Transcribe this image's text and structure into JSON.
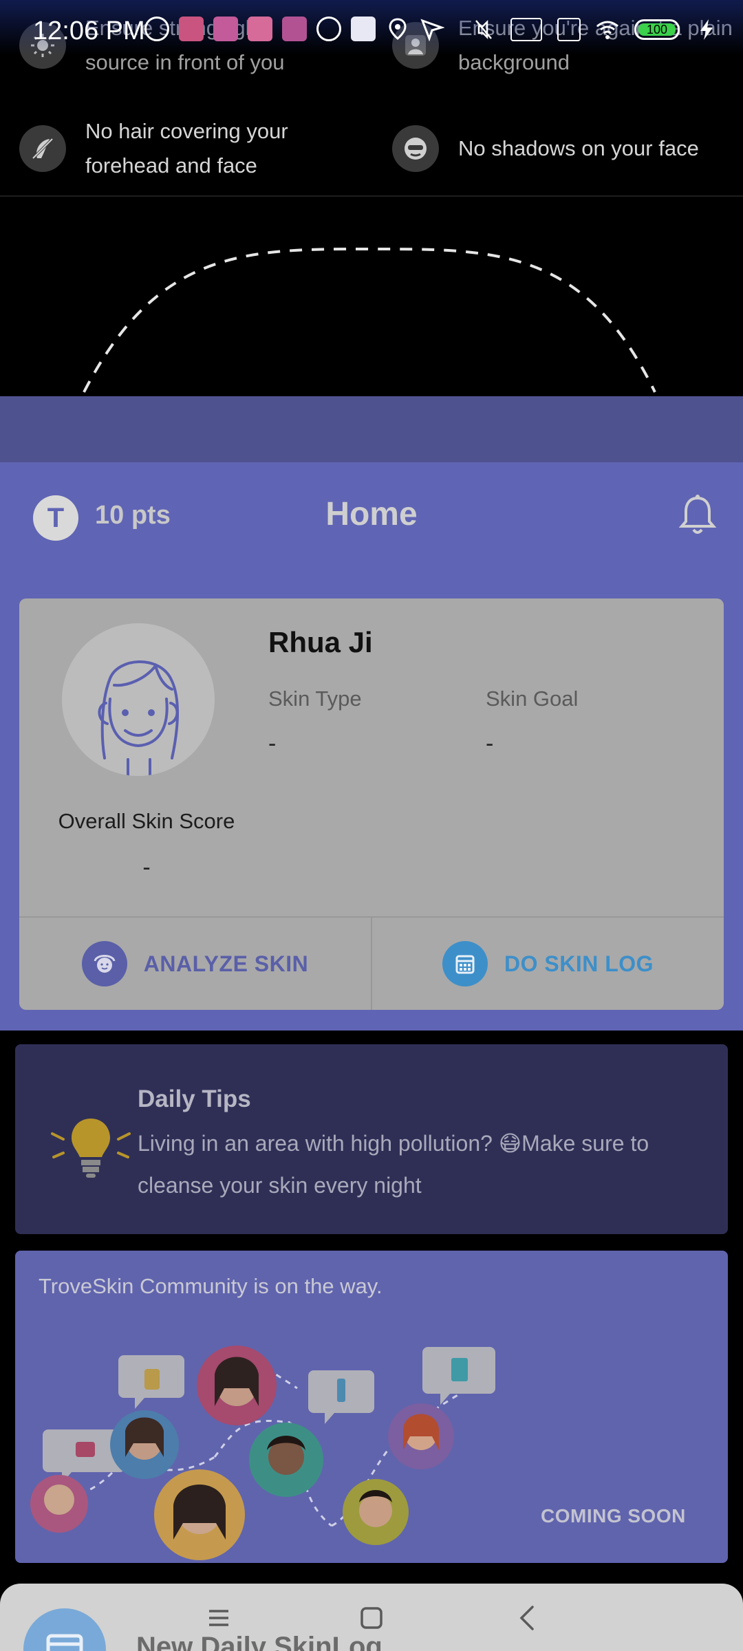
{
  "status_bar": {
    "time": "12:06 PM",
    "battery": "100",
    "icons_left": [
      "outlook-icon",
      "mi-icon",
      "app-icon",
      "app-icon",
      "app-icon",
      "at-icon",
      "download-icon",
      "location-icon",
      "navigation-icon"
    ],
    "icons_right": [
      "mute-icon",
      "volte-icon",
      "sim-icon",
      "wifi-icon",
      "battery-icon",
      "charging-icon"
    ]
  },
  "camera_tips": [
    {
      "icon": "brightness-icon",
      "text": "Ensure strong light source in front of you"
    },
    {
      "icon": "person-icon",
      "text": "Ensure you're against a plain background"
    },
    {
      "icon": "no-hair-icon",
      "text": "No hair covering your forehead and face"
    },
    {
      "icon": "no-shadow-icon",
      "text": "No shadows on your face"
    }
  ],
  "header": {
    "points_avatar_letter": "T",
    "points": "10 pts",
    "title": "Home"
  },
  "profile": {
    "name": "Rhua Ji",
    "skin_type_label": "Skin Type",
    "skin_type_value": "-",
    "skin_goal_label": "Skin Goal",
    "skin_goal_value": "-",
    "score_label": "Overall Skin Score",
    "score_value": "-",
    "analyze_label": "ANALYZE SKIN",
    "skin_log_label": "DO SKIN LOG"
  },
  "daily_tips": {
    "title": "Daily Tips",
    "text": "Living in an area with high pollution? 😷Make sure to cleanse your skin every night"
  },
  "community": {
    "title": "TroveSkin Community is on the way.",
    "badge": "COMING SOON"
  },
  "bottom_peek": {
    "text": "New Daily SkinLog"
  },
  "colors": {
    "primary": "#6064b4",
    "card": "#a9a9a9",
    "analyze": "#5a5fa8",
    "skin_log": "#3d8fc9",
    "tips_bg": "#2f2f56"
  }
}
